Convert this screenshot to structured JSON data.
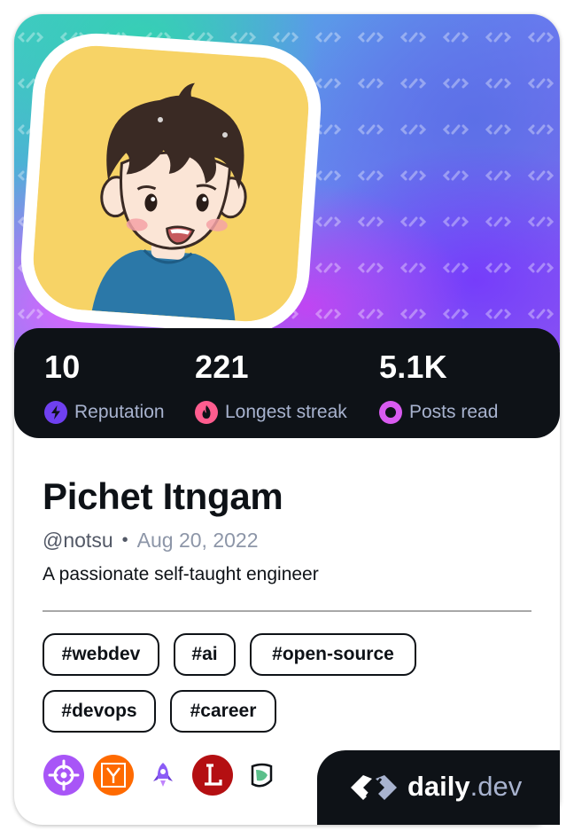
{
  "profile": {
    "name": "Pichet Itngam",
    "handle": "@notsu",
    "separator": "•",
    "joined": "Aug 20, 2022",
    "bio": "A passionate self-taught engineer"
  },
  "stats": [
    {
      "value": "10",
      "label": "Reputation",
      "icon": "bolt-icon",
      "color": "#6f40f0"
    },
    {
      "value": "221",
      "label": "Longest streak",
      "icon": "flame-icon",
      "color": "#ff5d8f"
    },
    {
      "value": "5.1K",
      "label": "Posts read",
      "icon": "eye-icon",
      "color": "#d95bf0"
    }
  ],
  "tags": [
    "#webdev",
    "#ai",
    "#open-source",
    "#devops",
    "#career"
  ],
  "sources": [
    {
      "name": "target-source-icon",
      "color": "#a855f7"
    },
    {
      "name": "ycombinator-icon",
      "letter": "Y",
      "color": "#ff6a00"
    },
    {
      "name": "rocket-icon",
      "color": "#8b5cf6"
    },
    {
      "name": "l-letter-icon",
      "letter": "L",
      "color": "#b40f12"
    },
    {
      "name": "leaf-app-icon",
      "color": "#0e1217"
    }
  ],
  "brand": {
    "main": "daily",
    "tld": ".dev"
  },
  "colors": {
    "card": "#ffffff",
    "dark": "#0e1217",
    "muted": "#a8b3cf",
    "avatar_bg": "#f7d366"
  }
}
